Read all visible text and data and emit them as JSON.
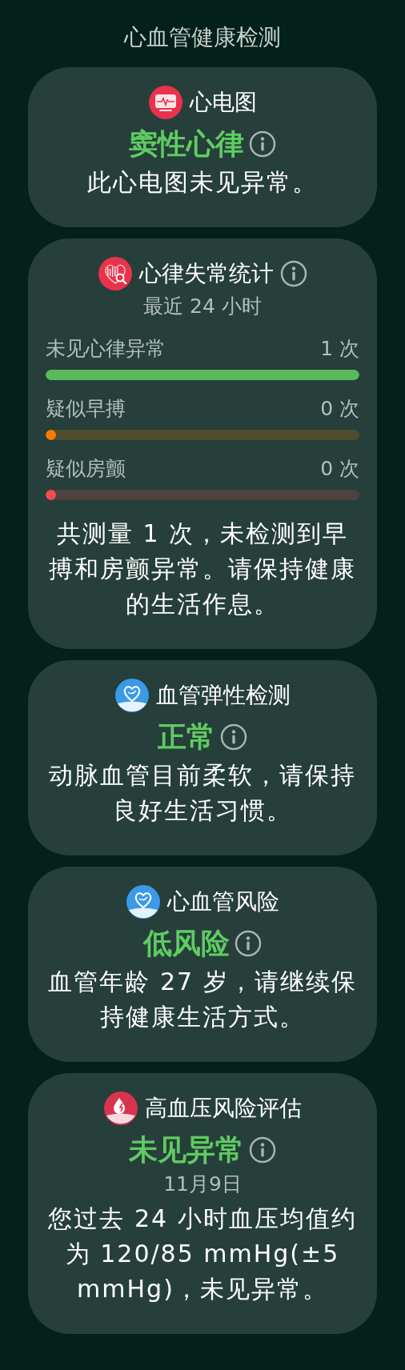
{
  "title": "心血管健康检测",
  "cards": [
    {
      "kind": "ecg",
      "heading": "心电图",
      "status": "窦性心律",
      "status_info": true,
      "description": "此心电图未见异常。"
    },
    {
      "kind": "arrhythmia",
      "heading": "心律失常统计",
      "heading_info": true,
      "subtitle": "最近 24 小时",
      "bars": [
        {
          "label": "未见心律异常",
          "count": "1 次",
          "level": 1,
          "color": "#5cb85c"
        },
        {
          "label": "疑似早搏",
          "count": "0 次",
          "level": 0,
          "color": "#f57c00"
        },
        {
          "label": "疑似房颤",
          "count": "0 次",
          "level": 0,
          "color": "#ef4f4f"
        }
      ],
      "description": "共测量 1 次，未检测到早搏和房颤异常。请保持健康的生活作息。"
    },
    {
      "kind": "vessel",
      "heading": "血管弹性检测",
      "status": "正常",
      "status_info": true,
      "description": "动脉血管目前柔软，请保持良好生活习惯。"
    },
    {
      "kind": "vessel",
      "heading": "心血管风险",
      "status": "低风险",
      "status_info": true,
      "description": "血管年龄 27 岁，请继续保持健康生活方式。"
    },
    {
      "kind": "pressure",
      "heading": "高血压风险评估",
      "status": "未见异常",
      "status_info": true,
      "subtitle": "11月9日",
      "description": "您过去 24 小时血压均值约为 120/85 mmHg(±5 mmHg)，未见异常。"
    }
  ]
}
